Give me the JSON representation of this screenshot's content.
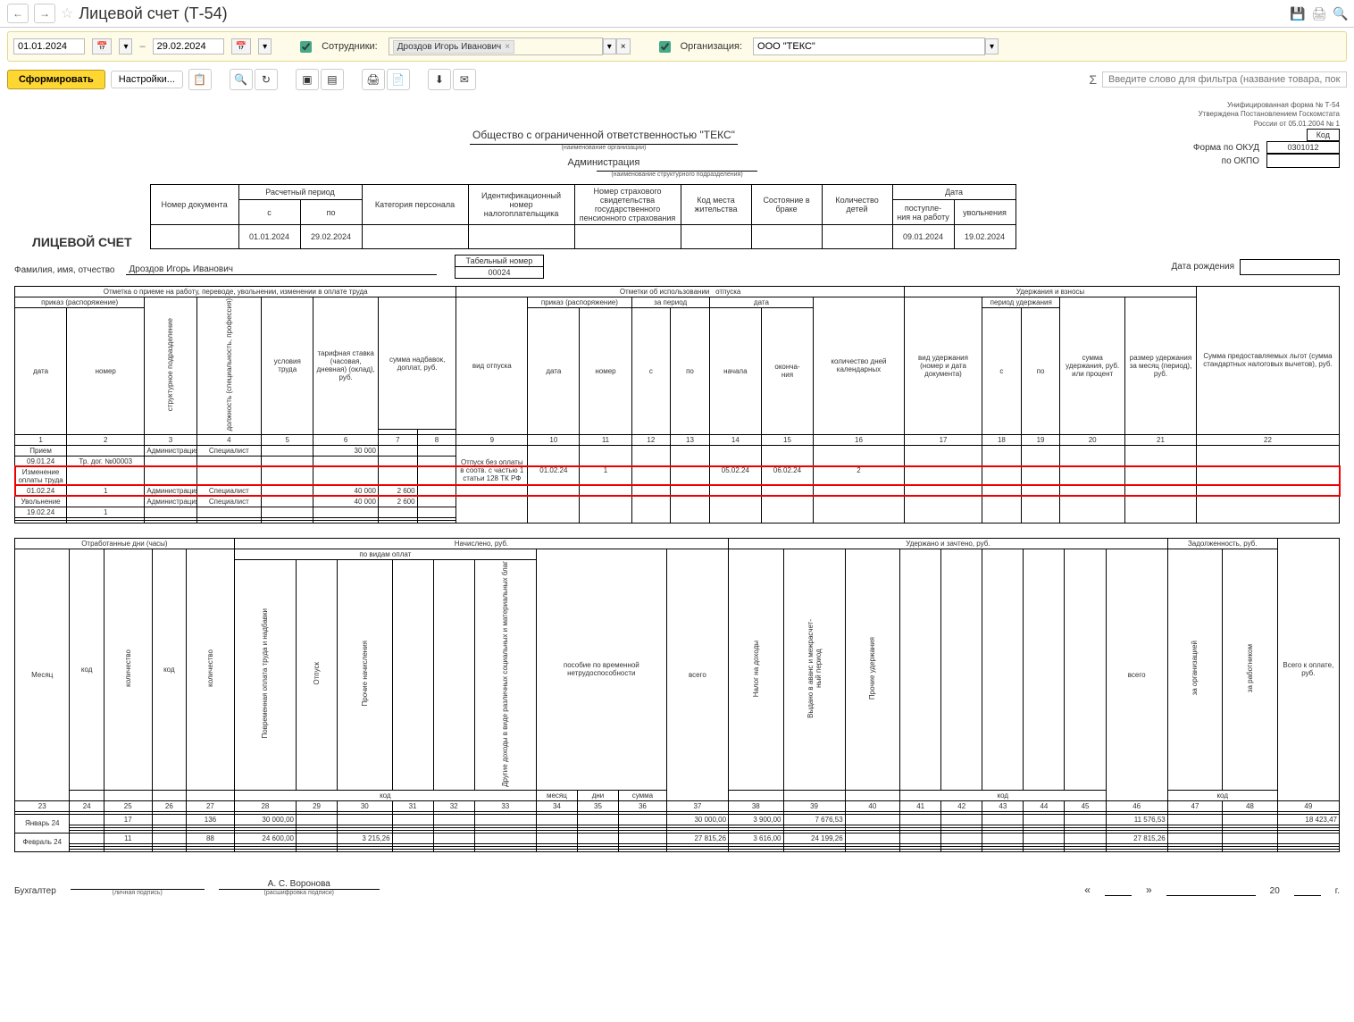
{
  "titlebar": {
    "title": "Лицевой счет (Т-54)"
  },
  "filter": {
    "date_from": "01.01.2024",
    "date_to": "29.02.2024",
    "employees_label": "Сотрудники:",
    "employee_tag": "Дроздов Игорь Иванович",
    "org_label": "Организация:",
    "org_value": "ООО \"ТЕКС\""
  },
  "toolbar": {
    "form": "Сформировать",
    "settings": "Настройки...",
    "filter_placeholder": "Введите слово для фильтра (название товара, покупателя и"
  },
  "meta": {
    "line1": "Унифицированная форма № Т-54",
    "line2": "Утверждена Постановлением Госкомстата",
    "line3": "России от 05.01.2004 № 1",
    "kod": "Код",
    "okud_label": "Форма по ОКУД",
    "okud": "0301012",
    "okpo_label": "по ОКПО"
  },
  "header": {
    "org_full": "Общество с ограниченной ответственностью \"ТЕКС\"",
    "org_sub": "(наименование организации)",
    "dept": "Администрация",
    "dept_sub": "(наименование структурного подразделения)",
    "doc_title": "ЛИЦЕВОЙ СЧЕТ",
    "h_docno": "Номер документа",
    "h_period": "Расчетный период",
    "h_from": "с",
    "h_to": "по",
    "h_cat": "Категория персонала",
    "h_inn": "Идентификационный номер налогоплательщика",
    "h_snils": "Номер страхового свидетельства государственного пенсионного страхования",
    "h_place": "Код места жительства",
    "h_marital": "Состояние в браке",
    "h_children": "Количество детей",
    "h_date": "Дата",
    "h_hired": "поступле-\nния на работу",
    "h_fired": "увольнения",
    "pf": "01.01.2024",
    "pt": "29.02.2024",
    "hired": "09.01.2024",
    "fired": "19.02.2024",
    "fio_label": "Фамилия, имя, отчество",
    "fio": "Дроздов Игорь Иванович",
    "tabno_label": "Табельный номер",
    "tabno": "00024",
    "dob_label": "Дата рождения"
  },
  "sectA": {
    "hire_mark": "Отметка о приеме на работу, переводе, увольнении, изменении в оплате труда",
    "vac_mark": "Отметки об использовании",
    "vac_suffix": "отпуска",
    "hold_mark": "Удержания и взносы",
    "sum_benefit": "Сумма предоставляемых льгот (сумма стандартных налоговых вычетов), руб.",
    "order": "приказ (распоряжение)",
    "date": "дата",
    "no": "номер",
    "dept": "структурное подразделение",
    "job": "должность (специальность, профессия)",
    "cond": "условия труда",
    "rate": "тарифная ставка (часовая, дневная) (оклад), руб.",
    "addl": "сумма надбавок, доплат, руб.",
    "vac_type": "вид отпуска",
    "za_period": "за период",
    "c": "с",
    "po": "по",
    "d_start": "начала",
    "d_end": "оконча-\nния",
    "days": "количество дней календарных",
    "hold_type": "вид удержания (номер и дата документа)",
    "hold_period": "период удержания",
    "hold_sum": "сумма удержания, руб. или процент",
    "hold_monthly": "размер удержания за месяц (период), руб.",
    "rows": [
      {
        "c1": "Прием",
        "c2": "",
        "c3": "Администрация",
        "c4": "Специалист",
        "c6": "30 000"
      },
      {
        "c1": "09.01.24",
        "c2": "Тр. дог. №00003"
      },
      {
        "c1": "Изменение оплаты труда",
        "hl": true
      },
      {
        "c1": "01.02.24",
        "c2": "1",
        "c3": "Администрация",
        "c4": "Специалист",
        "c6": "40 000",
        "c7": "2 600",
        "hl": true
      },
      {
        "c1": "Увольнение",
        "c3": "Администрация",
        "c4": "Специалист",
        "c6": "40 000",
        "c7": "2 600"
      },
      {
        "c1": "19.02.24",
        "c2": "1"
      }
    ],
    "vac_row": {
      "c9": "Отпуск без оплаты в соотв. с частью 1 статьи 128 ТК РФ",
      "c10": "01.02.24",
      "c11": "1",
      "c14": "05.02.24",
      "c15": "06.02.24",
      "c16": "2"
    }
  },
  "sectB": {
    "worked": "Отработанные дни (часы)",
    "accrued": "Начислено, руб.",
    "held": "Удержано и зачтено, руб.",
    "debt": "Задолженность, руб.",
    "month": "Месяц",
    "code": "код",
    "qty": "количество",
    "by_types": "по видам оплат",
    "timepay": "Повременная оплата труда и надбавки",
    "vacation": "Отпуск",
    "other_acc": "Прочие начисления",
    "other_inc": "Другие доходы в виде различных социальных и материальных благ",
    "sick": "пособие по временной нетрудоспособности",
    "sick_m": "месяц",
    "sick_d": "дни",
    "sick_s": "сумма",
    "total": "всего",
    "ndfl": "Налог на доходы",
    "advance": "Выдано в аванс и межрасчет-\nный период",
    "other_h": "Прочие удержания",
    "by_org": "за организацией",
    "by_emp": "за работником",
    "to_pay": "Всего к оплате, руб.",
    "rows": [
      {
        "c23": "Январь 24",
        "c25": "17",
        "c27": "136",
        "c28": "30 000,00",
        "c37": "30 000,00",
        "c38": "3 900,00",
        "c39": "7 676,53",
        "c46": "11 576,53",
        "c49": "18 423,47"
      },
      {
        "c23": "Февраль 24",
        "c25": "11",
        "c27": "88",
        "c28": "24 600,00",
        "c30": "3 215,26",
        "c37": "27 815,26",
        "c38": "3 616,00",
        "c39": "24 199,26",
        "c46": "27 815,26"
      }
    ]
  },
  "footer": {
    "acct": "Бухгалтер",
    "sig_sub1": "(личная подпись)",
    "name": "А. С. Воронова",
    "sig_sub2": "(расшифровка подписи)",
    "y": "20",
    "g": "г."
  }
}
